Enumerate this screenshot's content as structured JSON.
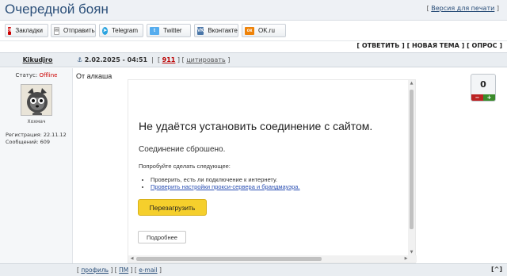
{
  "header": {
    "title": "Очередной боян",
    "print_version": "Версия для печати"
  },
  "share": [
    {
      "label": "Закладки",
      "icon": "yandex-icon",
      "icon_text": "Я",
      "color": "#cc0000"
    },
    {
      "label": "Отправить",
      "icon": "mail-icon",
      "icon_text": "✉",
      "color": "#8a8a8a"
    },
    {
      "label": "Telegram",
      "icon": "telegram-icon",
      "icon_text": "➤",
      "color": "#2aa3df"
    },
    {
      "label": "Twitter",
      "icon": "twitter-icon",
      "icon_text": "t",
      "color": "#55acee"
    },
    {
      "label": "Вконтакте",
      "icon": "vk-icon",
      "icon_text": "VK",
      "color": "#4a76a8"
    },
    {
      "label": "OK.ru",
      "icon": "ok-icon",
      "icon_text": "ок",
      "color": "#ee8208"
    }
  ],
  "actions": {
    "reply": "ОТВЕТИТЬ",
    "new_topic": "НОВАЯ ТЕМА",
    "poll": "ОПРОС"
  },
  "post": {
    "author": "Kikudjro",
    "date": "2.02.2025 - 04:51",
    "number": "911",
    "quote": "цитировать",
    "text": "От алкаша"
  },
  "user": {
    "status_label": "Статус:",
    "status_value": "Offline",
    "title": "Хохмач",
    "registration": "Регистрация: 22.11.12",
    "messages": "Сообщений: 609"
  },
  "error_page": {
    "title": "Не удаётся установить соединение с сайтом.",
    "subtitle": "Соединение сброшено.",
    "try": "Попробуйте сделать следующее:",
    "item1": "Проверить, есть ли подключение к интернету.",
    "item2": "Проверить настройки прокси-сервера и брандмауэра.",
    "reload": "Перезагрузить",
    "details": "Подробнее"
  },
  "rating": {
    "value": "0",
    "minus": "−",
    "plus": "+"
  },
  "footer": {
    "profile": "профиль",
    "pm": "ПМ",
    "email": "e-mail",
    "top": "^"
  }
}
